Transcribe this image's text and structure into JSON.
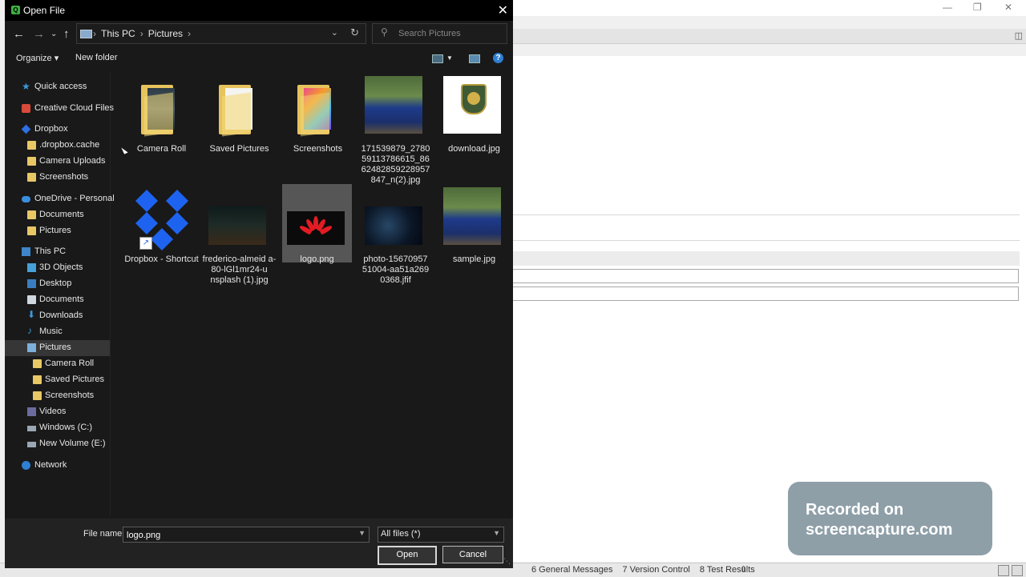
{
  "dialog": {
    "title": "Open File",
    "nav": {
      "back_icon": "back-arrow-icon",
      "forward_icon": "forward-arrow-icon",
      "recent_icon": "chevron-down-icon",
      "up_icon": "up-arrow-icon",
      "breadcrumb": [
        "This PC",
        "Pictures"
      ],
      "search_placeholder": "Search Pictures"
    },
    "toolbar": {
      "organize_label": "Organize ▾",
      "new_folder_label": "New folder"
    },
    "sidebar": {
      "items": [
        {
          "label": "Quick access",
          "icon": "star-icon"
        },
        {
          "label": "Creative Cloud Files",
          "icon": "creative-cloud-folder-icon"
        },
        {
          "label": "Dropbox",
          "icon": "dropbox-icon"
        },
        {
          "label": ".dropbox.cache",
          "icon": "folder-icon"
        },
        {
          "label": "Camera Uploads",
          "icon": "folder-icon"
        },
        {
          "label": "Screenshots",
          "icon": "folder-icon"
        },
        {
          "label": "OneDrive - Personal",
          "icon": "onedrive-icon"
        },
        {
          "label": "Documents",
          "icon": "folder-icon"
        },
        {
          "label": "Pictures",
          "icon": "folder-icon"
        },
        {
          "label": "This PC",
          "icon": "computer-icon"
        },
        {
          "label": "3D Objects",
          "icon": "3d-objects-icon"
        },
        {
          "label": "Desktop",
          "icon": "desktop-icon"
        },
        {
          "label": "Documents",
          "icon": "documents-icon"
        },
        {
          "label": "Downloads",
          "icon": "downloads-icon"
        },
        {
          "label": "Music",
          "icon": "music-icon"
        },
        {
          "label": "Pictures",
          "icon": "pictures-icon"
        },
        {
          "label": "Camera Roll",
          "icon": "folder-icon"
        },
        {
          "label": "Saved Pictures",
          "icon": "folder-icon"
        },
        {
          "label": "Screenshots",
          "icon": "folder-icon"
        },
        {
          "label": "Videos",
          "icon": "videos-icon"
        },
        {
          "label": "Windows (C:)",
          "icon": "drive-icon"
        },
        {
          "label": "New Volume (E:)",
          "icon": "drive-icon"
        },
        {
          "label": "Network",
          "icon": "network-icon"
        }
      ],
      "selected": "Pictures"
    },
    "files": [
      {
        "name": "Camera Roll",
        "type": "folder"
      },
      {
        "name": "Saved Pictures",
        "type": "folder"
      },
      {
        "name": "Screenshots",
        "type": "folder"
      },
      {
        "name": "171539879_2780 59113786615_86 62482859228957 847_n(2).jpg",
        "type": "image"
      },
      {
        "name": "download.jpg",
        "type": "image"
      },
      {
        "name": "Dropbox - Shortcut",
        "type": "shortcut"
      },
      {
        "name": "frederico-almeid a-80-lGl1mr24-u nsplash (1).jpg",
        "type": "image"
      },
      {
        "name": "logo.png",
        "type": "image",
        "selected": true
      },
      {
        "name": "photo-15670957 51004-aa51a269 0368.jfif",
        "type": "image"
      },
      {
        "name": "sample.jpg",
        "type": "image"
      }
    ],
    "footer": {
      "file_name_label": "File name:",
      "file_name_value": "logo.png",
      "filter_value": "All files (*)",
      "open_label": "Open",
      "cancel_label": "Cancel"
    }
  },
  "background_app": {
    "status_tabs": [
      "6 General Messages",
      "7 Version Control",
      "8 Test Results"
    ]
  },
  "watermark": {
    "line1": "Recorded on",
    "line2": "screencapture.com"
  },
  "colors": {
    "dialog_bg": "#191919",
    "selection_bg": "#565656",
    "accent": "#2f7fd3"
  }
}
